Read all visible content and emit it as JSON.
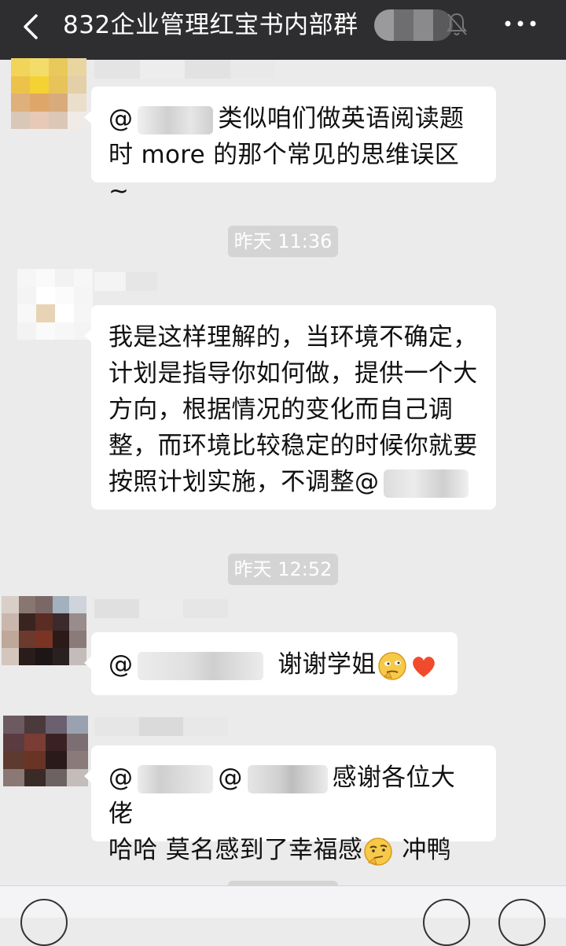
{
  "header": {
    "title": "832企业管理红宝书内部群",
    "back_icon": "back-chevron-icon",
    "mute_icon": "bell-off-icon",
    "more_icon": "more-dots-icon"
  },
  "messages": [
    {
      "mention_prefix": "@",
      "text": "类似咱们做英语阅读题时 more 的那个常见的思维误区 ~"
    },
    {
      "text": "我是这样理解的，当环境不确定，计划是指导你如何做，提供一个大方向，根据情况的变化而自己调整，而环境比较稳定的时候你就要按照计划实施，不调整@"
    },
    {
      "mention_prefix": "@",
      "text": "谢谢学姐",
      "emojis": [
        "thinking-face-icon",
        "red-heart-icon"
      ]
    },
    {
      "mention_prefix": "@",
      "mention_prefix2": "@",
      "text_line1": "感谢各位大佬",
      "text_line2": "哈哈 莫名感到了幸福感",
      "text_after_emoji": "冲鸭",
      "emojis": [
        "thinking-face-icon"
      ]
    }
  ],
  "timestamps": [
    "昨天 11:36",
    "昨天 12:52"
  ],
  "colors": {
    "header_bg": "#2e2e30",
    "chat_bg": "#ebebeb",
    "bubble_bg": "#ffffff",
    "timestamp_bg": "#d4d4d4"
  }
}
